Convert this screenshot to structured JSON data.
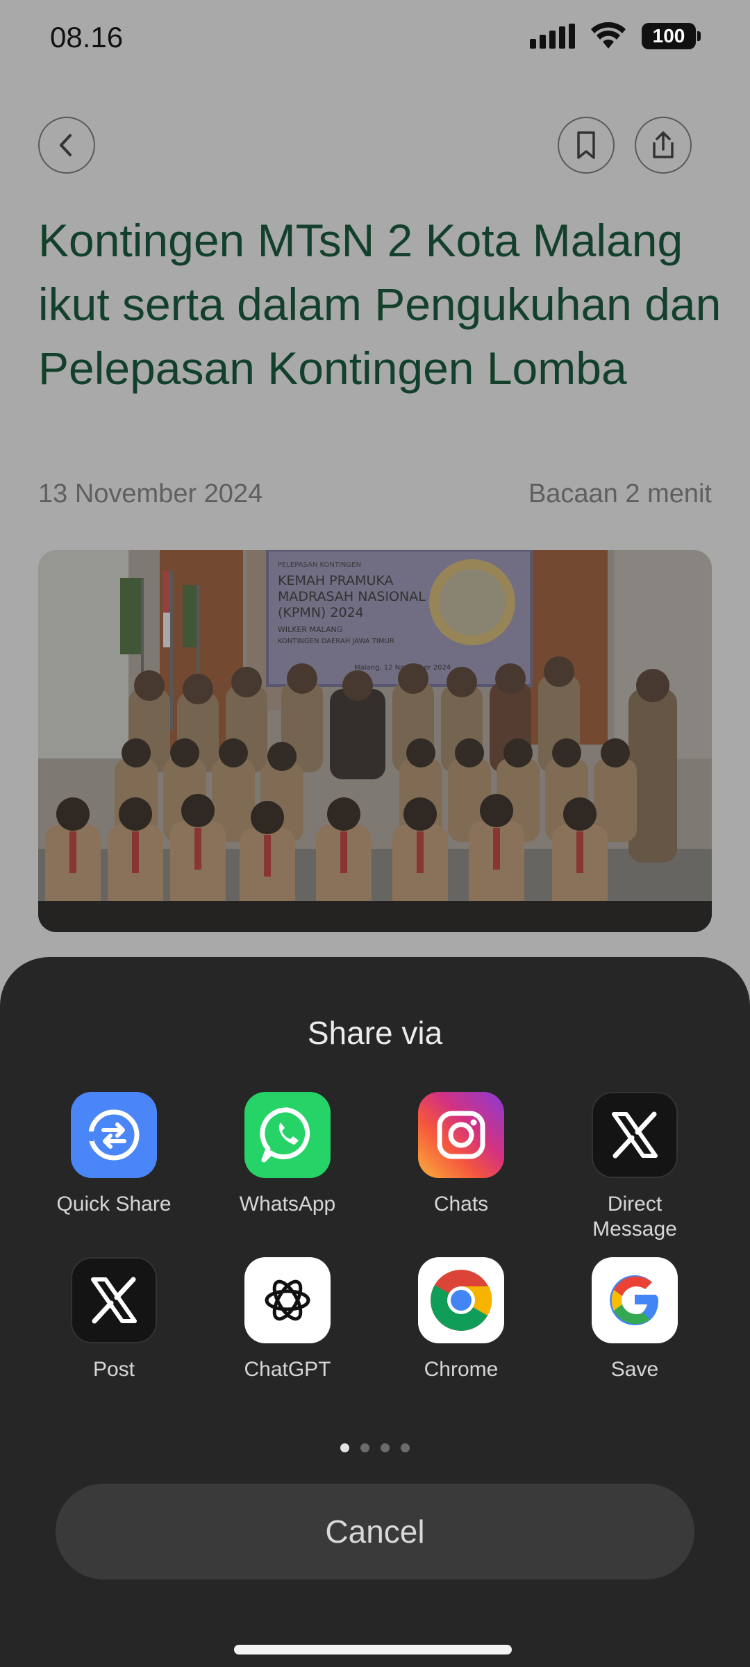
{
  "status": {
    "time": "08.16",
    "battery": "100"
  },
  "article": {
    "title": "Kontingen MTsN 2 Kota Malang ikut serta dalam Pengukuhan dan Pelepasan Kontingen Lomba",
    "date": "13 November 2024",
    "read_time": "Bacaan 2 menit",
    "photo": {
      "banner_line1": "PELEPASAN KONTINGEN",
      "banner_line2": "KEMAH PRAMUKA",
      "banner_line3": "MADRASAH NASIONAL",
      "banner_line4": "(KPMN) 2024",
      "banner_line5": "WILKER MALANG",
      "banner_line6": "KONTINGEN DAERAH JAWA TIMUR",
      "banner_line7": "Malang, 12 November 2024"
    }
  },
  "share_sheet": {
    "title": "Share via",
    "apps": [
      {
        "label": "Quick Share",
        "icon": "quick-share-icon"
      },
      {
        "label": "WhatsApp",
        "icon": "whatsapp-icon"
      },
      {
        "label": "Chats",
        "icon": "instagram-icon"
      },
      {
        "label": "Direct Message",
        "icon": "x-icon"
      },
      {
        "label": "Post",
        "icon": "x-icon"
      },
      {
        "label": "ChatGPT",
        "icon": "chatgpt-icon"
      },
      {
        "label": "Chrome",
        "icon": "chrome-icon"
      },
      {
        "label": "Save",
        "icon": "google-icon"
      }
    ],
    "page_count": 4,
    "current_page": 1,
    "cancel_label": "Cancel"
  },
  "colors": {
    "title": "#13402c",
    "sheet_bg": "#262626",
    "quick_share": "#4a86f7",
    "whatsapp": "#25d366"
  }
}
